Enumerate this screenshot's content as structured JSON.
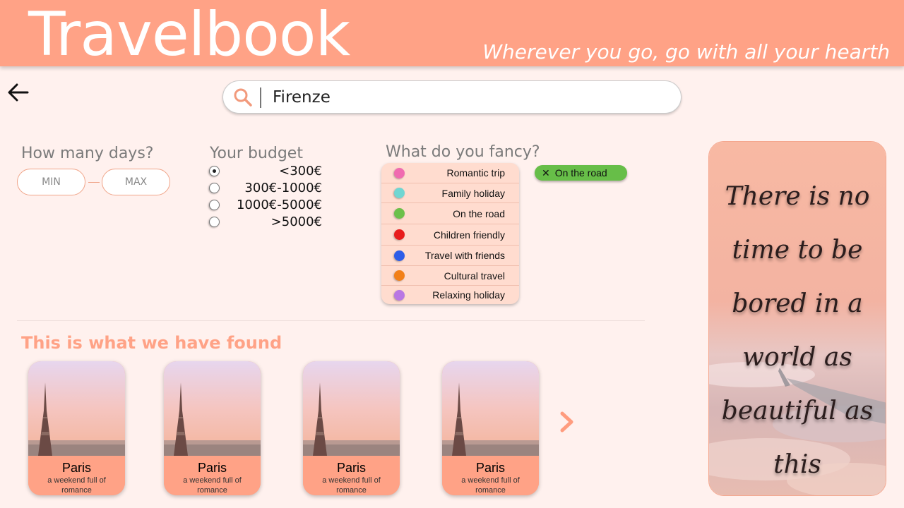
{
  "header": {
    "brand": "Travelbook",
    "tagline": "Wherever you go, go with all your hearth"
  },
  "nav": {
    "back_icon": "arrow-left-icon"
  },
  "search": {
    "icon": "search-icon",
    "value": "Firenze"
  },
  "days": {
    "label": "How many days?",
    "min_placeholder": "MIN",
    "max_placeholder": "MAX"
  },
  "budget": {
    "label": "Your budget",
    "options": [
      {
        "label": "<300€",
        "selected": true
      },
      {
        "label": "300€-1000€",
        "selected": false
      },
      {
        "label": "1000€-5000€",
        "selected": false
      },
      {
        "label": ">5000€",
        "selected": false
      }
    ]
  },
  "fancy": {
    "label": "What do you fancy?",
    "options": [
      {
        "label": "Romantic trip",
        "color": "#f06bb0"
      },
      {
        "label": "Family holiday",
        "color": "#6fd6d2"
      },
      {
        "label": "On the road",
        "color": "#6cc04a"
      },
      {
        "label": "Children friendly",
        "color": "#e81c1c"
      },
      {
        "label": "Travel with friends",
        "color": "#2d5de8"
      },
      {
        "label": "Cultural travel",
        "color": "#f28018"
      },
      {
        "label": "Relaxing holiday",
        "color": "#b977e3"
      }
    ],
    "selected_chip": {
      "label": "On the road",
      "close_icon": "close-icon",
      "color": "#67be48"
    }
  },
  "results": {
    "title": "This is what we have found",
    "next_icon": "chevron-right-icon",
    "cards": [
      {
        "city": "Paris",
        "description": "a weekend full of romance",
        "image": "eiffel-tower-image"
      },
      {
        "city": "Paris",
        "description": "a weekend full of romance",
        "image": "eiffel-tower-image"
      },
      {
        "city": "Paris",
        "description": "a weekend full of romance",
        "image": "eiffel-tower-image"
      },
      {
        "city": "Paris",
        "description": "a weekend full of romance",
        "image": "eiffel-tower-image"
      }
    ]
  },
  "quote": {
    "lines": [
      "There is no",
      "time to be",
      "bored in a",
      "world as",
      "beautiful as",
      "this"
    ]
  },
  "colors": {
    "accent": "#ffa286",
    "background": "#fff1ee"
  }
}
